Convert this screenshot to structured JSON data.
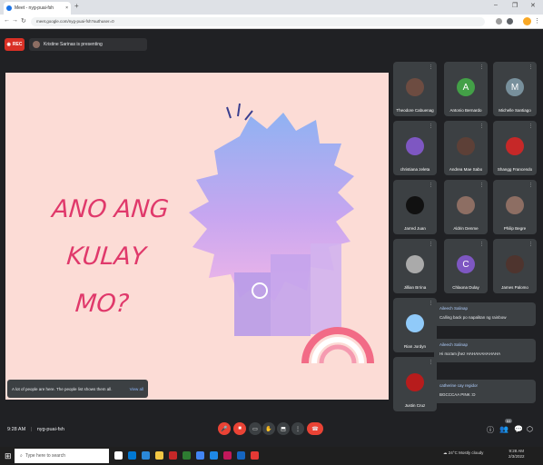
{
  "browser": {
    "tab_title": "Meet - nyg-puai-fsh",
    "url": "meet.google.com/nyg-puai-fsh?authuser=0",
    "new_tab": "+",
    "minimize": "–",
    "maximize": "❐",
    "close": "✕"
  },
  "meet": {
    "rec_label": "REC",
    "presenting_text": "Kristine Sarinas is presenting",
    "slide_title_line1": "ANO ANG KULAY",
    "slide_title_line2": "MO?",
    "toast_text": "A lot of people are here. The people list shows them all.",
    "toast_action": "View all",
    "time": "9:28 AM",
    "meeting_code": "nyg-puai-fsh",
    "people_count": "64"
  },
  "participants": [
    {
      "name": "Theodore Cabuenag",
      "initial": "",
      "color": "#6d4c41"
    },
    {
      "name": "Antonio Bernardo",
      "initial": "A",
      "color": "#43a047"
    },
    {
      "name": "Michelle Santiago",
      "initial": "M",
      "color": "#78909c"
    },
    {
      "name": "christiana zeleta",
      "initial": "",
      "color": "#7e57c2"
    },
    {
      "name": "Andrea Mae Sabo",
      "initial": "",
      "color": "#5d4037"
    },
    {
      "name": "Shangg Francendo",
      "initial": "",
      "color": "#c62828"
    },
    {
      "name": "Jarred Juan",
      "initial": "",
      "color": "#111111"
    },
    {
      "name": "Aldrin Denme",
      "initial": "",
      "color": "#8d6e63"
    },
    {
      "name": "Philip Begre",
      "initial": "",
      "color": "#8d6e63"
    },
    {
      "name": "Jillian Brrina",
      "initial": "",
      "color": "#aaaaaa"
    },
    {
      "name": "Chlaona Dulay",
      "initial": "C",
      "color": "#7e57c2"
    },
    {
      "name": "James Palomo",
      "initial": "",
      "color": "#4e342e"
    },
    {
      "name": "Rian Jordyn",
      "initial": "",
      "color": "#90caf9"
    },
    {
      "name": "Justin Cruz",
      "initial": "",
      "color": "#b71c1c"
    }
  ],
  "chats": [
    {
      "who": "Aileech Salinap",
      "msg": "Calling back po napalitan ng rainbow"
    },
    {
      "who": "Aileech Salinap",
      "msg": "Hi ma'am jhez HAHAHAHAHAHA"
    },
    {
      "who": "catherine cay regidor",
      "msg": "BGCCCAA PINK :D"
    }
  ],
  "taskbar": {
    "search_placeholder": "Type here to search",
    "weather": "24°C  Mostly cloudy",
    "clock_time": "9:28 AM",
    "clock_date": "2/3/2022"
  },
  "colors": {
    "accent_red": "#ea4335",
    "slide_bg": "#fcdcd6",
    "slide_text": "#e0396b"
  }
}
